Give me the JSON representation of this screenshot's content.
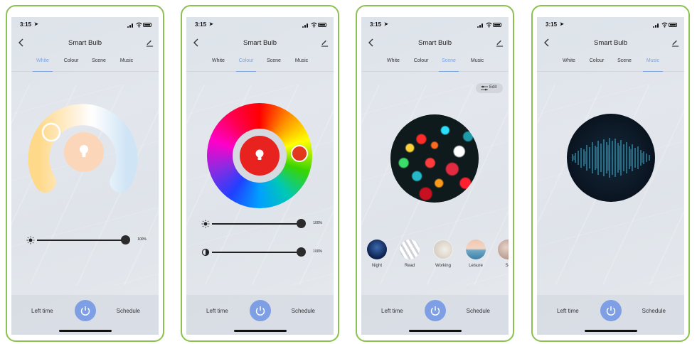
{
  "status_time": "3:15",
  "app_title": "Smart Bulb",
  "tabs": [
    "White",
    "Colour",
    "Scene",
    "Music"
  ],
  "bottom": {
    "left": "Left time",
    "right": "Schedule"
  },
  "white_panel": {
    "brightness_pct": "100%"
  },
  "colour_panel": {
    "brightness_pct": "100%",
    "saturation_pct": "100%",
    "selected_color": "#e8231f"
  },
  "scene_panel": {
    "edit_label": "Edit",
    "scenes": [
      {
        "label": "Night"
      },
      {
        "label": "Read"
      },
      {
        "label": "Working"
      },
      {
        "label": "Leisure"
      },
      {
        "label": "Sc"
      }
    ]
  },
  "colors": {
    "accent": "#7aa2e0",
    "power": "#7f9fe4",
    "frame": "#8cc152"
  },
  "icons": [
    "back-arrow-icon",
    "edit-pencil-icon",
    "power-icon",
    "bulb-icon",
    "sun-icon",
    "contrast-icon",
    "adjust-icon"
  ]
}
